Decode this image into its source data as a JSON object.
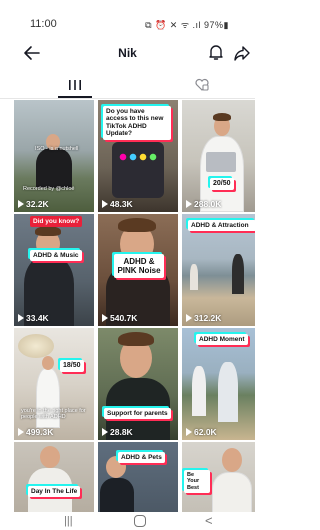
{
  "status": {
    "time": "11:00",
    "icons_text": "⧉ ⏰ ✕ ᯤ .ıl 97%▮",
    "battery": "97%"
  },
  "header": {
    "title": "Nik"
  },
  "icons": [
    "back-arrow-icon",
    "bell-icon",
    "share-icon",
    "videos-grid-icon",
    "liked-videos-icon",
    "play-icon"
  ],
  "colors": {
    "caption_red": "#ff2d55",
    "caption_cyan": "#25f4ee",
    "accent_red": "#e8213a"
  },
  "videos": [
    {
      "views": "32.2K",
      "caption": "ISO - is a nutshell",
      "caption2": "Recorded by @chloé"
    },
    {
      "views": "48.3K",
      "caption": "Do you have access to this new TikTok ADHD Update?"
    },
    {
      "views": "288.0K",
      "caption": "20/50"
    },
    {
      "views": "33.4K",
      "caption": "ADHD & Music",
      "caption2": "Did you know?"
    },
    {
      "views": "540.7K",
      "caption": "ADHD & PINK Noise"
    },
    {
      "views": "312.2K",
      "caption": "ADHD & Attraction"
    },
    {
      "views": "499.3K",
      "caption": "18/50",
      "caption2": "you're in the right place for people with ADHD"
    },
    {
      "views": "28.8K",
      "caption": "Support for parents"
    },
    {
      "views": "62.0K",
      "caption": "ADHD Moment"
    },
    {
      "views": "",
      "caption": "Day In The Life"
    },
    {
      "views": "",
      "caption": "ADHD & Pets"
    },
    {
      "views": "",
      "caption": "Be Your Best"
    }
  ],
  "nav": {
    "recent": "|||",
    "back": "<"
  }
}
